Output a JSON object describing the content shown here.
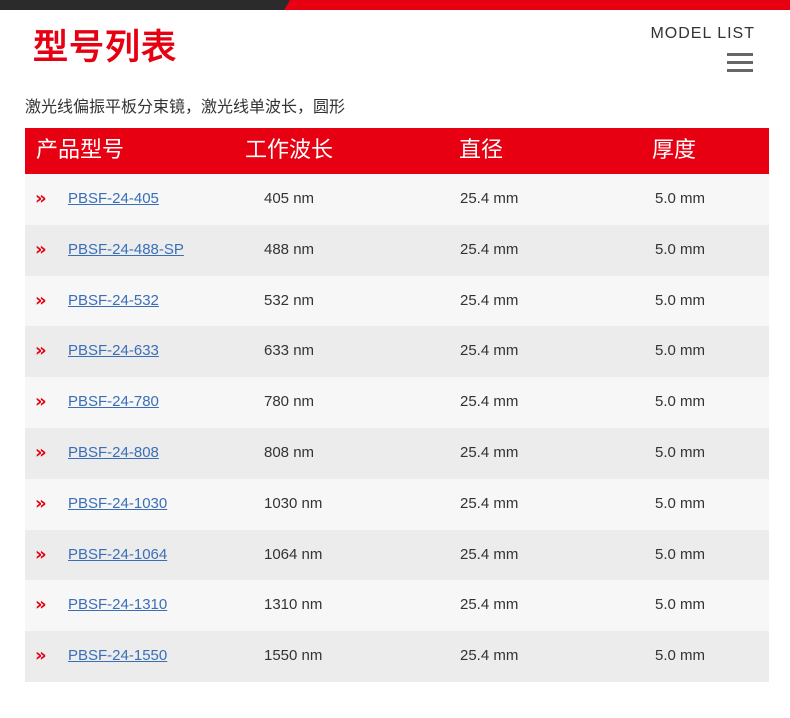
{
  "header": {
    "title": "型号列表",
    "model_list_label": "MODEL LIST",
    "menu_icon": "hamburger-menu-icon"
  },
  "subtitle": "激光线偏振平板分束镜，激光线单波长，圆形",
  "table": {
    "columns": [
      "产品型号",
      "工作波长",
      "直径",
      "厚度"
    ],
    "row_marker": "»",
    "rows": [
      {
        "model": "PBSF-24-405",
        "wavelength": "405 nm",
        "diameter": "25.4 mm",
        "thickness": "5.0 mm"
      },
      {
        "model": "PBSF-24-488-SP",
        "wavelength": "488 nm",
        "diameter": "25.4 mm",
        "thickness": "5.0 mm"
      },
      {
        "model": "PBSF-24-532",
        "wavelength": "532 nm",
        "diameter": "25.4 mm",
        "thickness": "5.0 mm"
      },
      {
        "model": "PBSF-24-633",
        "wavelength": "633 nm",
        "diameter": "25.4 mm",
        "thickness": "5.0 mm"
      },
      {
        "model": "PBSF-24-780",
        "wavelength": "780 nm",
        "diameter": "25.4 mm",
        "thickness": "5.0 mm"
      },
      {
        "model": "PBSF-24-808",
        "wavelength": "808 nm",
        "diameter": "25.4 mm",
        "thickness": "5.0 mm"
      },
      {
        "model": "PBSF-24-1030",
        "wavelength": "1030 nm",
        "diameter": "25.4 mm",
        "thickness": "5.0 mm"
      },
      {
        "model": "PBSF-24-1064",
        "wavelength": "1064 nm",
        "diameter": "25.4 mm",
        "thickness": "5.0 mm"
      },
      {
        "model": "PBSF-24-1310",
        "wavelength": "1310 nm",
        "diameter": "25.4 mm",
        "thickness": "5.0 mm"
      },
      {
        "model": "PBSF-24-1550",
        "wavelength": "1550 nm",
        "diameter": "25.4 mm",
        "thickness": "5.0 mm"
      }
    ]
  },
  "colors": {
    "accent": "#e60012",
    "link": "#3a6fb7",
    "row_light": "#f7f7f7",
    "row_dark": "#ececec"
  }
}
